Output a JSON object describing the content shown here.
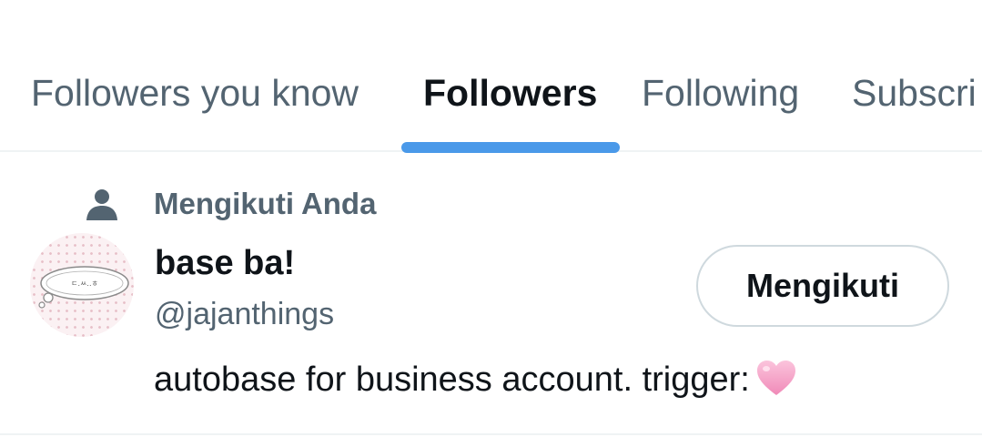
{
  "tabs": [
    {
      "label": "Followers you know",
      "active": false
    },
    {
      "label": "Followers",
      "active": true
    },
    {
      "label": "Following",
      "active": false
    },
    {
      "label": "Subscri",
      "active": false
    }
  ],
  "user": {
    "follows_you_label": "Mengikuti Anda",
    "display_name": "base ba!",
    "handle": "@jajanthings",
    "follow_button_label": "Mengikuti",
    "bio": "autobase for business account. trigger:",
    "bio_emoji_icon": "pink-heart-icon",
    "avatar_text": "ㄷ.ㅆ..ㅎ"
  },
  "colors": {
    "active_tab_indicator": "#4a99e9",
    "secondary_text": "#536471",
    "primary_text": "#0f1419",
    "divider": "#eff3f4",
    "heart": "#f7a8c8"
  }
}
